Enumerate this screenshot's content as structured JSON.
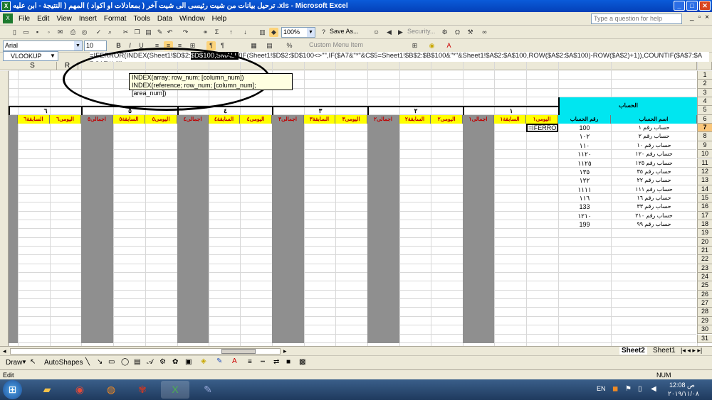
{
  "window": {
    "title": "ترحيل بيانات من شيت رئيسى الى شيت آخر ( بمعادلات او اكواد ) المهم ( النتيجة - ابن عليه .xls - Microsoft Excel"
  },
  "menu": [
    "File",
    "Edit",
    "View",
    "Insert",
    "Format",
    "Tools",
    "Data",
    "Window",
    "Help"
  ],
  "help_placeholder": "Type a question for help",
  "toolbar": {
    "zoom": "100%",
    "save_as": "Save As...",
    "font": "Arial",
    "size": "10",
    "custom_menu_item": "Custom Menu Item",
    "security": "Security..."
  },
  "namebox": "VLOOKUP",
  "formula": {
    "pre": "=IFERROR(INDEX(Sheet1!$D$2:",
    "sel": "$D$100,SMALL",
    "post": "(IF(Sheet1!$D$2:$D$100<>\"\",IF($A7&\"*\"&C$5=Sheet1!$B$2:$B$100&\"*\"&Sheet1!$A$2:$A$100,ROW($A$2:$A$100)-ROW($A$2)+1)),COUNTIF($A$7:$A7,$A7))),\"\")"
  },
  "tooltip": {
    "line1": "INDEX(array; row_num; [column_num])",
    "line2": "INDEX(reference; row_num; [column_num]; [area_num])"
  },
  "columns": {
    "s": "S",
    "r": "R"
  },
  "rows": [
    "1",
    "2",
    "3",
    "4",
    "5",
    "6",
    "7",
    "8",
    "9",
    "10",
    "11",
    "12",
    "13",
    "14",
    "15",
    "16",
    "17",
    "18",
    "19",
    "20",
    "21",
    "22",
    "23",
    "24",
    "25",
    "26",
    "27",
    "28",
    "29",
    "30",
    "31"
  ],
  "header": {
    "account": "الحساب",
    "acc_number": "رقم الحساب",
    "acc_name": "اسم الحساب"
  },
  "groups": [
    "١",
    "٢",
    "٣",
    "٤",
    "٥",
    "٦"
  ],
  "sub": {
    "g1": {
      "daily": "اليومى١",
      "prev": "السابقة١",
      "total": "اجمالى١"
    },
    "g2": {
      "daily": "اليومى٢",
      "prev": "السابقة٢",
      "total": "اجمالى٢"
    },
    "g3": {
      "daily": "اليومى٣",
      "prev": "السابقة٣",
      "total": "اجمالى٣"
    },
    "g4": {
      "daily": "اليومى٤",
      "prev": "السابقة٤",
      "total": "اجمالى٤"
    },
    "g5": {
      "daily": "اليومى٥",
      "prev": "السابقة٥",
      "total": "اجمالى٥"
    },
    "g6": {
      "daily": "اليومى٦",
      "prev": "السابقة٦"
    }
  },
  "active_cell": "=IFERRO",
  "accounts": [
    {
      "num": "100",
      "name": "حساب رقم ١"
    },
    {
      "num": "١٠٢",
      "name": "حساب رقم ٢"
    },
    {
      "num": "١١٠",
      "name": "حساب رقم ١٠"
    },
    {
      "num": "١١٢٠",
      "name": "حساب رقم ١٢٠"
    },
    {
      "num": "١١٢٥",
      "name": "حساب رقم ١٢٥"
    },
    {
      "num": "١٣٥",
      "name": "حساب رقم ٣٥"
    },
    {
      "num": "١٢٢",
      "name": "حساب رقم ٢٢"
    },
    {
      "num": "١١١١",
      "name": "حساب رقم ١١١"
    },
    {
      "num": "١١٦",
      "name": "حساب رقم ١٦"
    },
    {
      "num": "133",
      "name": "حساب رقم ٣٣"
    },
    {
      "num": "١٢١٠",
      "name": "حساب رقم ٢١٠"
    },
    {
      "num": "199",
      "name": "حساب رقم ٩٩"
    }
  ],
  "tabs": {
    "sheet2": "Sheet2",
    "sheet1": "Sheet1"
  },
  "draw": {
    "draw": "Draw",
    "autoshapes": "AutoShapes"
  },
  "status": {
    "mode": "Edit",
    "num": "NUM"
  },
  "tray": {
    "lang": "EN",
    "time": "12:08 ص",
    "date": "٢٠١٩/١١/٠٨"
  }
}
